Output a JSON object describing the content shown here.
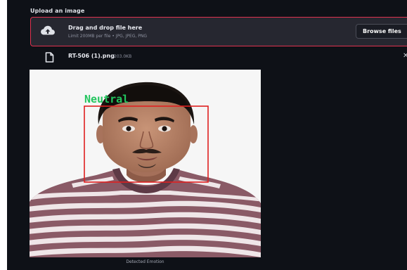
{
  "uploader": {
    "label": "Upload an image",
    "dropzone_title": "Drag and drop file here",
    "dropzone_limit": "Limit 200MB per file • JPG, JPEG, PNG",
    "browse_button": "Browse files",
    "cloud_icon": "cloud-upload-icon",
    "accent_color": "#e0334f"
  },
  "uploaded_file": {
    "name": "RT-506 (1).png",
    "size": "203.0KB",
    "file_icon": "file-icon",
    "remove_icon": "close-icon"
  },
  "result": {
    "emotion_label": "Neutral",
    "label_color": "#22c55e",
    "box_color": "#e02020",
    "caption": "Detected Emotion"
  }
}
